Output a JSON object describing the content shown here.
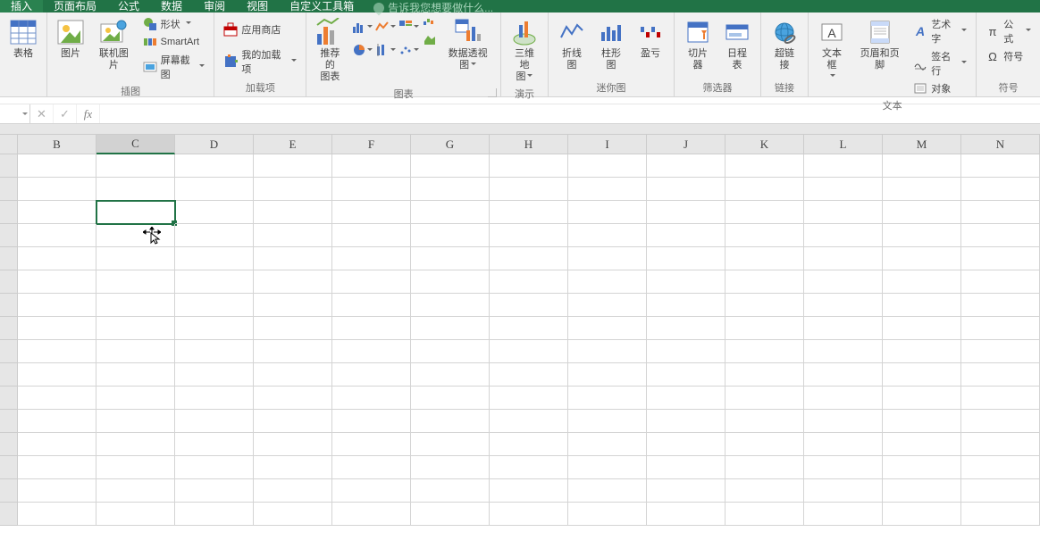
{
  "tabs": {
    "insert": "插入",
    "layout": "页面布局",
    "formulas": "公式",
    "data": "数据",
    "review": "审阅",
    "view": "视图",
    "custom": "自定义工具箱"
  },
  "tell_me": "告诉我您想要做什么...",
  "ribbon": {
    "tables": {
      "table": "表格"
    },
    "illustrations": {
      "label": "插图",
      "pictures": "图片",
      "online_pictures": "联机图片",
      "shapes": "形状",
      "smartart": "SmartArt",
      "screenshot": "屏幕截图"
    },
    "addins": {
      "label": "加载项",
      "store": "应用商店",
      "my_addins": "我的加载项"
    },
    "charts": {
      "label": "图表",
      "recommended": "推荐的\n图表",
      "pivot_chart": "数据透视图"
    },
    "tours": {
      "label": "演示",
      "map3d": "三维地\n图"
    },
    "sparklines": {
      "label": "迷你图",
      "line": "折线图",
      "column": "柱形图",
      "winloss": "盈亏"
    },
    "filters": {
      "label": "筛选器",
      "slicer": "切片器",
      "timeline": "日程表"
    },
    "links": {
      "label": "链接",
      "hyperlink": "超链接"
    },
    "text": {
      "label": "文本",
      "textbox": "文本框",
      "header_footer": "页眉和页脚",
      "wordart": "艺术字",
      "signature": "签名行",
      "object": "对象"
    },
    "symbols": {
      "label": "符号",
      "equation": "公式",
      "symbol": "符号"
    }
  },
  "columns": [
    "B",
    "C",
    "D",
    "E",
    "F",
    "G",
    "H",
    "I",
    "J",
    "K",
    "L",
    "M",
    "N"
  ],
  "active_column": "C",
  "row_count": 16,
  "active_row_index": 2,
  "active_col_index": 1
}
